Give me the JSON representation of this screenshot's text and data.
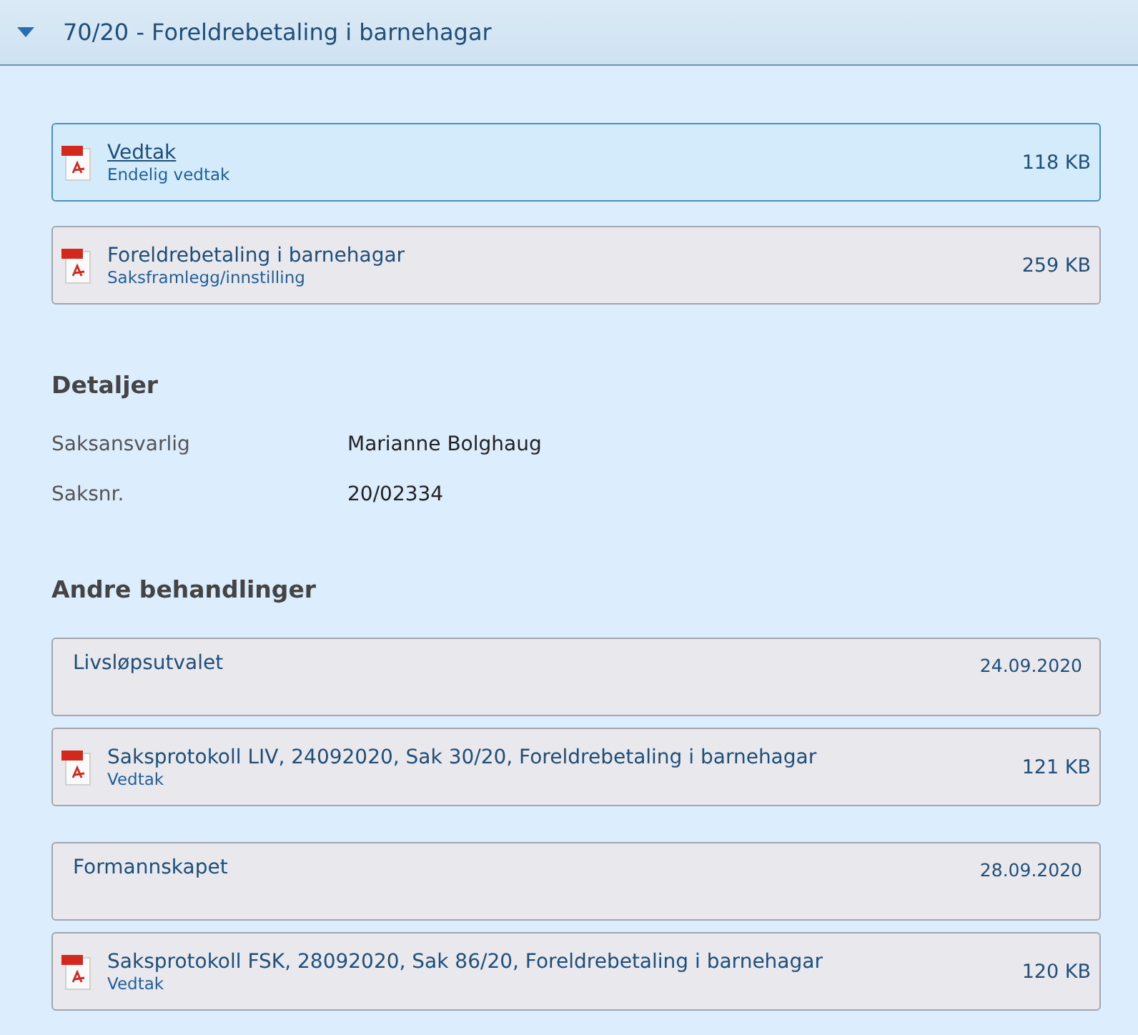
{
  "header": {
    "title": "70/20 - Foreldrebetaling i barnehagar",
    "expanded": true
  },
  "documents": [
    {
      "title": "Vedtak",
      "subtitle": "Endelig vedtak",
      "size": "118 KB",
      "selected": true
    },
    {
      "title": "Foreldrebetaling i barnehagar",
      "subtitle": "Saksframlegg/innstilling",
      "size": "259 KB",
      "selected": false
    }
  ],
  "details": {
    "heading": "Detaljer",
    "rows": [
      {
        "label": "Saksansvarlig",
        "value": "Marianne Bolghaug"
      },
      {
        "label": "Saksnr.",
        "value": "20/02334"
      }
    ]
  },
  "other": {
    "heading": "Andre behandlinger",
    "meetings": [
      {
        "name": "Livsløpsutvalet",
        "date": "24.09.2020",
        "documents": [
          {
            "title": "Saksprotokoll LIV, 24092020, Sak 30/20, Foreldrebetaling i barnehagar",
            "subtitle": "Vedtak",
            "size": "121 KB",
            "selected": false
          }
        ]
      },
      {
        "name": "Formannskapet",
        "date": "28.09.2020",
        "documents": [
          {
            "title": "Saksprotokoll FSK, 28092020, Sak 86/20, Foreldrebetaling i barnehagar",
            "subtitle": "Vedtak",
            "size": "120 KB",
            "selected": false
          }
        ]
      }
    ]
  }
}
